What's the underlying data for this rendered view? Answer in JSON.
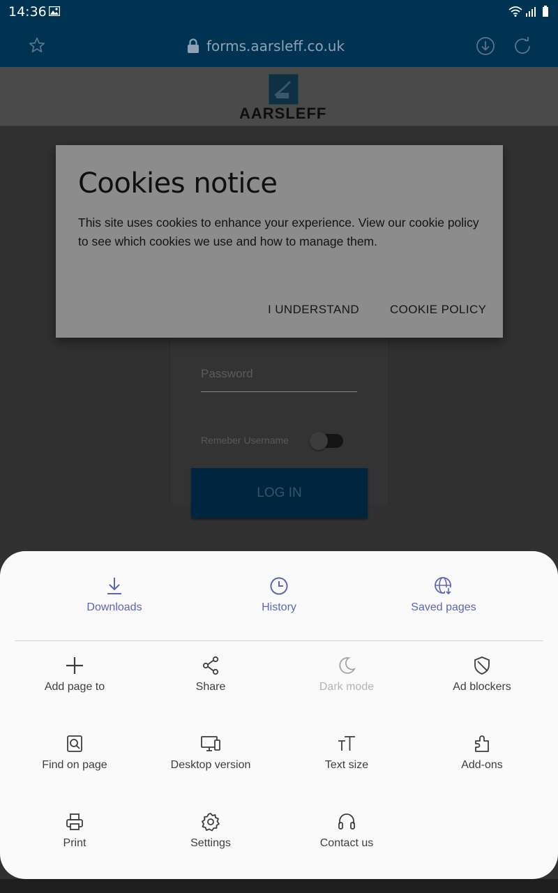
{
  "status_bar": {
    "time": "14:36"
  },
  "browser": {
    "url": "forms.aarsleff.co.uk"
  },
  "page": {
    "logo_text": "AARSLEFF",
    "password_placeholder": "Password",
    "remember_label": "Remeber Username",
    "login_label": "LOG IN"
  },
  "cookie_dialog": {
    "title": "Cookies notice",
    "body": "This site uses cookies to enhance your experience. View our cookie policy to see which cookies we use and how to manage them.",
    "understand_label": "I UNDERSTAND",
    "policy_label": "COOKIE POLICY"
  },
  "menu": {
    "top": [
      {
        "label": "Downloads",
        "icon": "download-icon"
      },
      {
        "label": "History",
        "icon": "history-icon"
      },
      {
        "label": "Saved pages",
        "icon": "saved-pages-icon"
      }
    ],
    "items": [
      {
        "label": "Add page to",
        "icon": "plus-icon"
      },
      {
        "label": "Share",
        "icon": "share-icon"
      },
      {
        "label": "Dark mode",
        "icon": "moon-icon",
        "disabled": true
      },
      {
        "label": "Ad blockers",
        "icon": "shield-icon"
      },
      {
        "label": "Find on page",
        "icon": "find-icon"
      },
      {
        "label": "Desktop version",
        "icon": "desktop-icon"
      },
      {
        "label": "Text size",
        "icon": "text-size-icon"
      },
      {
        "label": "Add-ons",
        "icon": "puzzle-icon"
      },
      {
        "label": "Print",
        "icon": "print-icon"
      },
      {
        "label": "Settings",
        "icon": "gear-icon"
      },
      {
        "label": "Contact us",
        "icon": "headset-icon"
      }
    ]
  },
  "colors": {
    "toolbar": "#003352",
    "menu_accent": "#5a66b5",
    "sheet_bg": "#fafafa"
  }
}
